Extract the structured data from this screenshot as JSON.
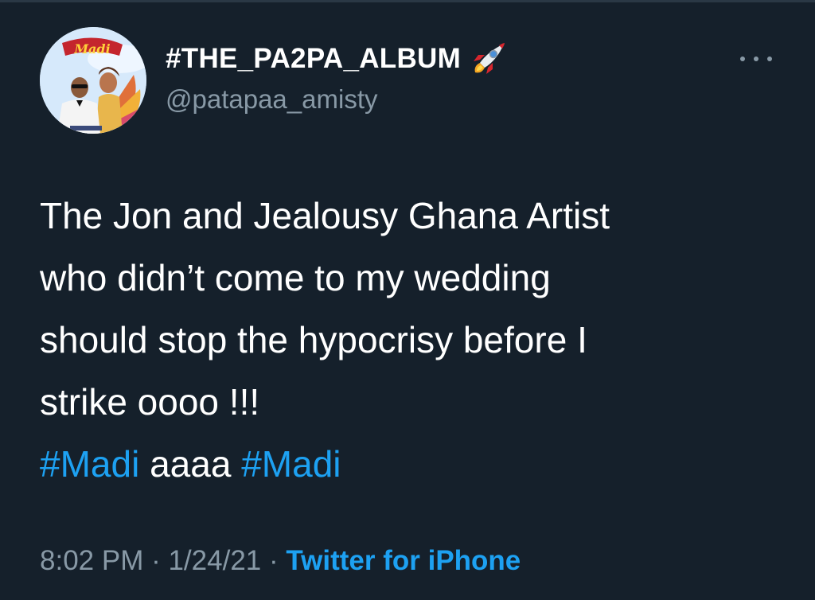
{
  "tweet": {
    "display_name": "#THE_PA2PA_ALBUM",
    "handle": "@patapaa_amisty",
    "body_lines": [
      "The Jon and Jealousy Ghana Artist",
      "who didn’t come to my wedding",
      "should stop the hypocrisy before I",
      "strike oooo !!!"
    ],
    "hashtag_1": "#Madi",
    "middle_text": " aaaa ",
    "hashtag_2": "#Madi",
    "time": "8:02 PM",
    "separator_1": " · ",
    "date": "1/24/21",
    "separator_2": " · ",
    "source": "Twitter for iPhone"
  },
  "avatar": {
    "logo_text": "Madi"
  },
  "icons": {
    "name_emoji": "rocket-icon",
    "more": "more-horizontal-icon"
  },
  "colors": {
    "background": "#15202b",
    "text_primary": "#ffffff",
    "text_secondary": "#8899a6",
    "accent": "#1da1f2"
  }
}
